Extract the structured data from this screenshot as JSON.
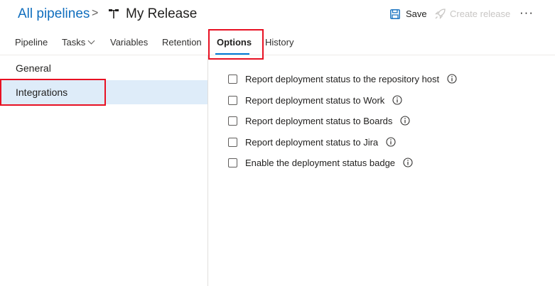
{
  "header": {
    "breadcrumb_root": "All pipelines",
    "breadcrumb_separator": ">",
    "title": "My Release",
    "save_label": "Save",
    "create_release_label": "Create release",
    "more_label": "···"
  },
  "tabs": [
    {
      "label": "Pipeline"
    },
    {
      "label": "Tasks"
    },
    {
      "label": "Variables"
    },
    {
      "label": "Retention"
    },
    {
      "label": "Options",
      "selected": true
    },
    {
      "label": "History"
    }
  ],
  "sidebar": {
    "items": [
      {
        "label": "General"
      },
      {
        "label": "Integrations",
        "selected": true
      }
    ]
  },
  "options": [
    {
      "label": "Report deployment status to the repository host",
      "checked": false
    },
    {
      "label": "Report deployment status to Work",
      "checked": false
    },
    {
      "label": "Report deployment status to Boards",
      "checked": false
    },
    {
      "label": "Report deployment status to Jira",
      "checked": false
    },
    {
      "label": "Enable the deployment status badge",
      "checked": false
    }
  ],
  "colors": {
    "accent": "#0078d4",
    "link": "#106ebe",
    "highlight_box": "#e81123",
    "selected_bg": "#deecf9",
    "disabled_text": "#c8c6c4"
  },
  "icons": {
    "pipeline": "release-pipeline-icon",
    "save": "save-icon",
    "create_release": "rocket-icon",
    "info": "info-icon",
    "tasks_dropdown": "chevron-down-icon"
  }
}
